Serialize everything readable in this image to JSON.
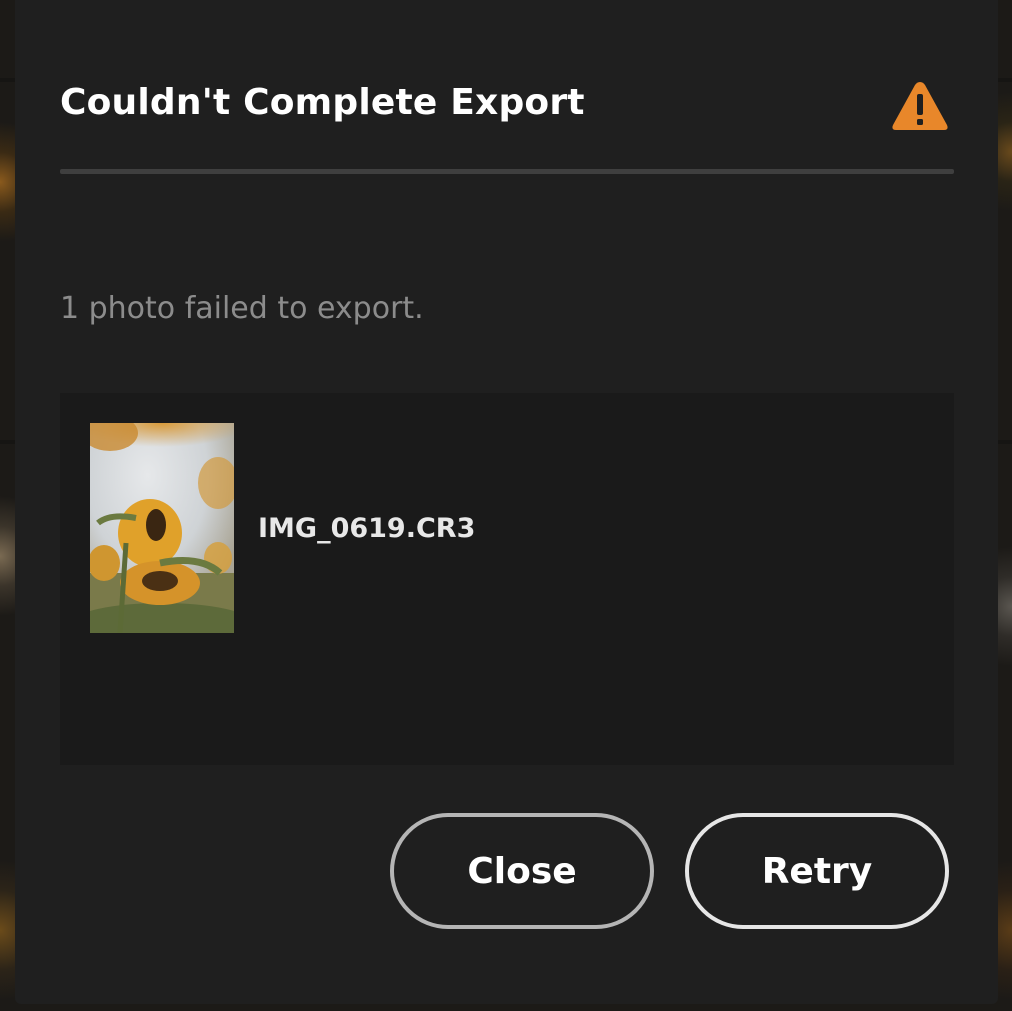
{
  "dialog": {
    "title": "Couldn't Complete Export",
    "alert_icon": "alert-triangle-icon",
    "message": "1 photo failed to export.",
    "files": [
      {
        "name": "IMG_0619.CR3",
        "thumbnail": "sunflower-photo"
      }
    ],
    "buttons": {
      "close_label": "Close",
      "retry_label": "Retry"
    }
  },
  "colors": {
    "alert": "#e8872a",
    "dialog_bg": "#1f1f1f",
    "list_bg": "#1a1a1a",
    "title_text": "#ffffff",
    "message_text": "#8c8c8c"
  }
}
